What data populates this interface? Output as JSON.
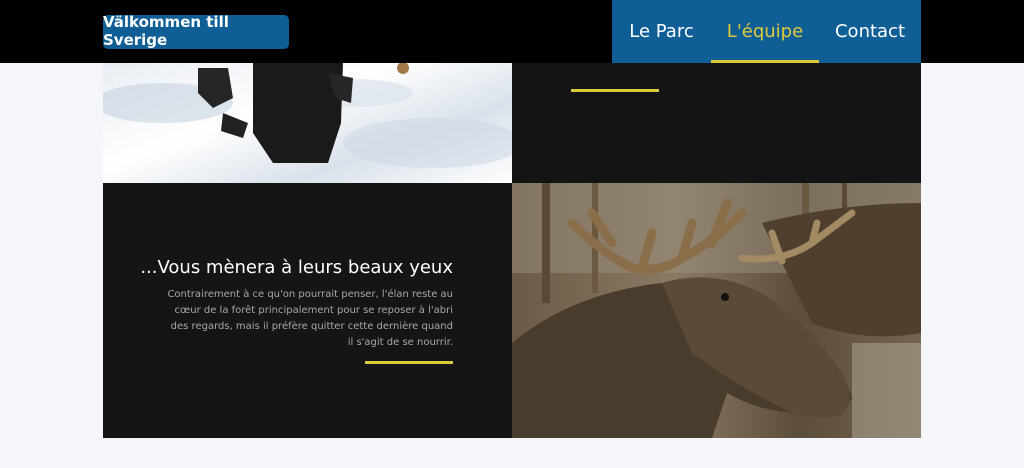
{
  "header": {
    "brand_label": "Välkommen till Sverige",
    "nav": [
      {
        "label": "Le Parc",
        "active": false
      },
      {
        "label": "L'équipe",
        "active": true
      },
      {
        "label": "Contact",
        "active": false
      }
    ]
  },
  "section": {
    "heading": "...Vous mènera à leurs beaux yeux",
    "paragraph": "Contrairement à ce qu'on pourrait penser, l'élan reste au cœur de la forêt principalement pour se reposer à l'abri des regards, mais il préfère quitter cette dernière quand il s'agit de se nourrir."
  },
  "colors": {
    "header_bg": "#000000",
    "brand_blue": "#0f5f96",
    "accent_yellow": "#ddc93a",
    "panel_dark": "#151515",
    "page_bg": "#f5f6f9"
  }
}
